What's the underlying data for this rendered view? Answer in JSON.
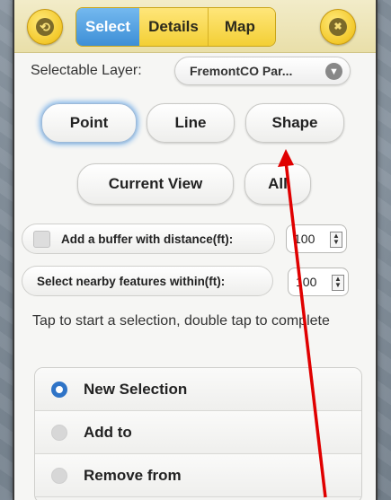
{
  "header": {
    "back_icon_glyph": "⟲",
    "close_icon_glyph": "✖",
    "tabs": [
      {
        "label": "Select",
        "active": true
      },
      {
        "label": "Details",
        "active": false
      },
      {
        "label": "Map",
        "active": false
      }
    ]
  },
  "layer": {
    "label": "Selectable Layer:",
    "value": "FremontCO Par..."
  },
  "geometry_buttons": {
    "point": "Point",
    "line": "Line",
    "shape": "Shape",
    "selected": "Point"
  },
  "extent_buttons": {
    "current_view": "Current View",
    "all": "All"
  },
  "buffer": {
    "label": "Add a buffer with distance(ft):",
    "value": "100",
    "checked": false
  },
  "nearby": {
    "label": "Select nearby features within(ft):",
    "value": "100"
  },
  "instruction": "Tap to start a selection, double tap to complete",
  "selection_modes": [
    {
      "label": "New Selection",
      "selected": true
    },
    {
      "label": "Add to",
      "selected": false
    },
    {
      "label": "Remove from",
      "selected": false
    }
  ],
  "colors": {
    "accent": "#2f74c7",
    "annotation_arrow": "#e00000",
    "tab_active": "#3d8fd6",
    "header_yellow": "#f3cf35"
  }
}
